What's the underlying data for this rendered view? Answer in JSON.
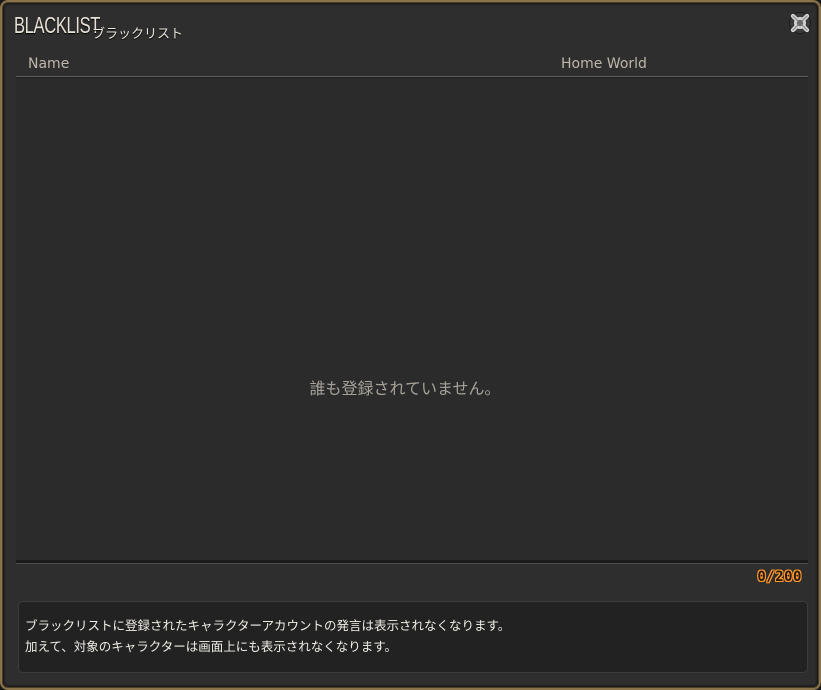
{
  "window": {
    "title_en": "BLACKLIST",
    "title_jp": "ブラックリスト",
    "close_icon": "close-x-icon",
    "accent_color": "#8a7348"
  },
  "table": {
    "columns": [
      "Name",
      "Home World"
    ],
    "empty_message": "誰も登録されていません。"
  },
  "counter": {
    "text": "0/200",
    "color": "#ff9a2e"
  },
  "info": {
    "lines": [
      "ブラックリストに登録されたキャラクターアカウントの発言は表示されなくなります。",
      "加えて、対象のキャラクターは画面上にも表示されなくなります。"
    ]
  }
}
